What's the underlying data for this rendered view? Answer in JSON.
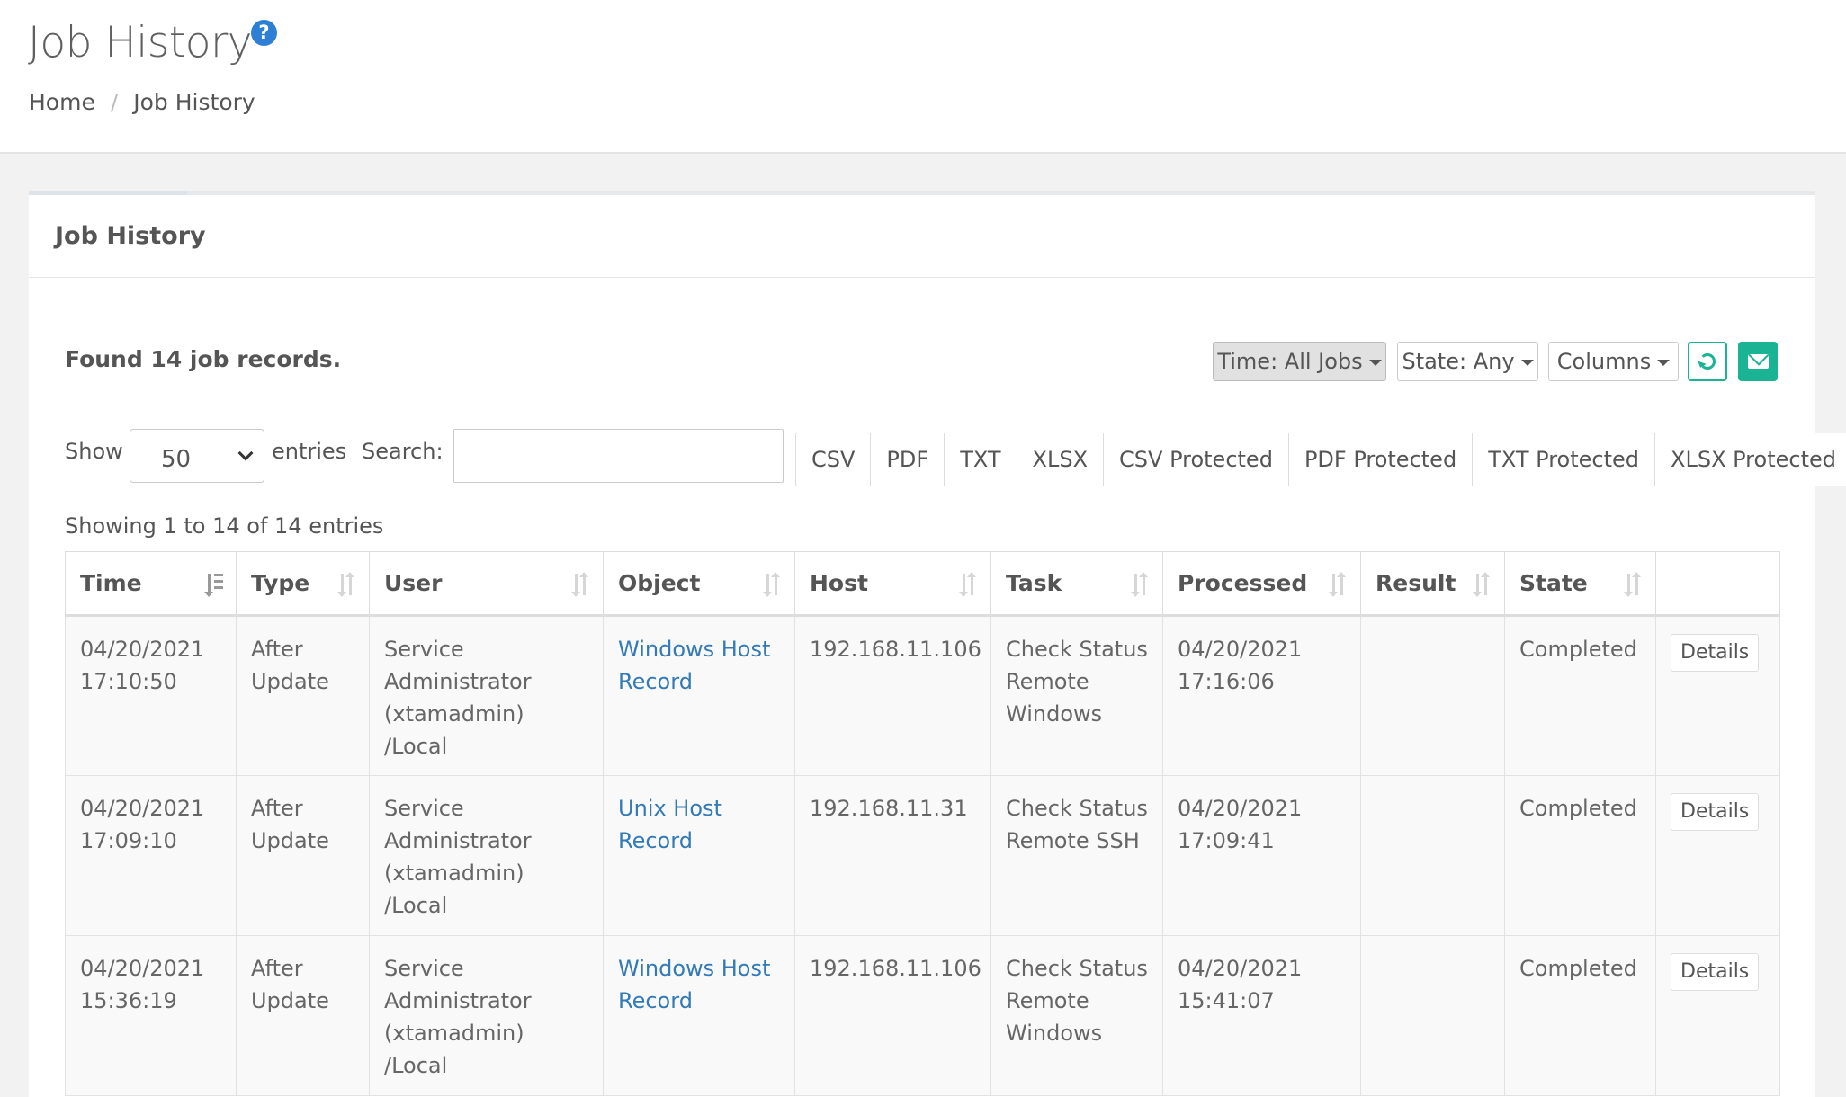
{
  "header": {
    "title": "Job History",
    "breadcrumb": [
      "Home",
      "Job History"
    ]
  },
  "panel": {
    "title": "Job History",
    "found_text": "Found 14 job records.",
    "filters": {
      "time_label": "Time: All Jobs",
      "state_label": "State: Any",
      "columns_label": "Columns"
    }
  },
  "controls": {
    "show_label": "Show",
    "page_length": "50",
    "entries_label": "entries",
    "search_label": "Search:",
    "search_value": "",
    "export_buttons": [
      "CSV",
      "PDF",
      "TXT",
      "XLSX",
      "CSV Protected",
      "PDF Protected",
      "TXT Protected",
      "XLSX Protected"
    ],
    "showing_text": "Showing 1 to 14 of 14 entries"
  },
  "table": {
    "columns": [
      "Time",
      "Type",
      "User",
      "Object",
      "Host",
      "Task",
      "Processed",
      "Result",
      "State",
      ""
    ],
    "details_label": "Details",
    "rows": [
      {
        "time": [
          "04/20/2021",
          "17:10:50"
        ],
        "type": [
          "After",
          "Update"
        ],
        "user": [
          "Service",
          "Administrator",
          "(xtamadmin)",
          "/Local"
        ],
        "object": [
          "Windows Host",
          "Record"
        ],
        "host": "192.168.11.106",
        "task": [
          "Check Status",
          "Remote",
          "Windows"
        ],
        "processed": [
          "04/20/2021",
          "17:16:06"
        ],
        "result": "",
        "state": "Completed"
      },
      {
        "time": [
          "04/20/2021",
          "17:09:10"
        ],
        "type": [
          "After",
          "Update"
        ],
        "user": [
          "Service",
          "Administrator",
          "(xtamadmin)",
          "/Local"
        ],
        "object": [
          "Unix Host",
          "Record"
        ],
        "host": "192.168.11.31",
        "task": [
          "Check Status",
          "Remote SSH"
        ],
        "processed": [
          "04/20/2021",
          "17:09:41"
        ],
        "result": "",
        "state": "Completed"
      },
      {
        "time": [
          "04/20/2021",
          "15:36:19"
        ],
        "type": [
          "After",
          "Update"
        ],
        "user": [
          "Service",
          "Administrator",
          "(xtamadmin)",
          "/Local"
        ],
        "object": [
          "Windows Host",
          "Record"
        ],
        "host": "192.168.11.106",
        "task": [
          "Check Status",
          "Remote",
          "Windows"
        ],
        "processed": [
          "04/20/2021",
          "15:41:07"
        ],
        "result": "",
        "state": "Completed"
      }
    ]
  },
  "colors": {
    "accent_green": "#1ab394",
    "link_blue": "#337ab7",
    "help_blue": "#2d7ed5"
  }
}
